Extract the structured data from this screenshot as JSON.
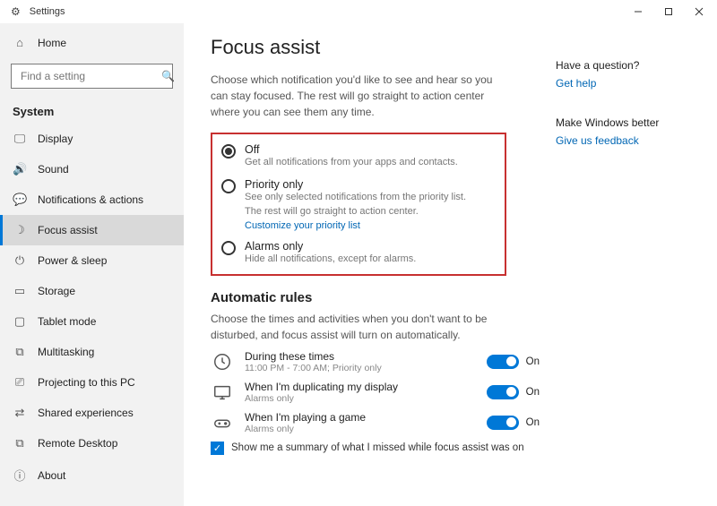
{
  "window": {
    "title": "Settings"
  },
  "sidebar": {
    "home": "Home",
    "search_placeholder": "Find a setting",
    "category": "System",
    "items": [
      {
        "label": "Display"
      },
      {
        "label": "Sound"
      },
      {
        "label": "Notifications & actions"
      },
      {
        "label": "Focus assist"
      },
      {
        "label": "Power & sleep"
      },
      {
        "label": "Storage"
      },
      {
        "label": "Tablet mode"
      },
      {
        "label": "Multitasking"
      },
      {
        "label": "Projecting to this PC"
      },
      {
        "label": "Shared experiences"
      },
      {
        "label": "Remote Desktop"
      },
      {
        "label": "About"
      }
    ]
  },
  "page": {
    "title": "Focus assist",
    "description": "Choose which notification you'd like to see and hear so you can stay focused. The rest will go straight to action center where you can see them any time.",
    "radios": {
      "off_title": "Off",
      "off_desc": "Get all notifications from your apps and contacts.",
      "priority_title": "Priority only",
      "priority_desc": "See only selected notifications from the priority list. The rest will go straight to action center.",
      "priority_link": "Customize your priority list",
      "alarms_title": "Alarms only",
      "alarms_desc": "Hide all notifications, except for alarms."
    },
    "auto_rules": {
      "heading": "Automatic rules",
      "desc": "Choose the times and activities when you don't want to be disturbed, and focus assist will turn on automatically.",
      "rules": [
        {
          "title": "During these times",
          "desc": "11:00 PM - 7:00 AM; Priority only",
          "state": "On"
        },
        {
          "title": "When I'm duplicating my display",
          "desc": "Alarms only",
          "state": "On"
        },
        {
          "title": "When I'm playing a game",
          "desc": "Alarms only",
          "state": "On"
        }
      ],
      "summary": "Show me a summary of what I missed while focus assist was on"
    }
  },
  "right": {
    "q_heading": "Have a question?",
    "q_link": "Get help",
    "fb_heading": "Make Windows better",
    "fb_link": "Give us feedback"
  }
}
